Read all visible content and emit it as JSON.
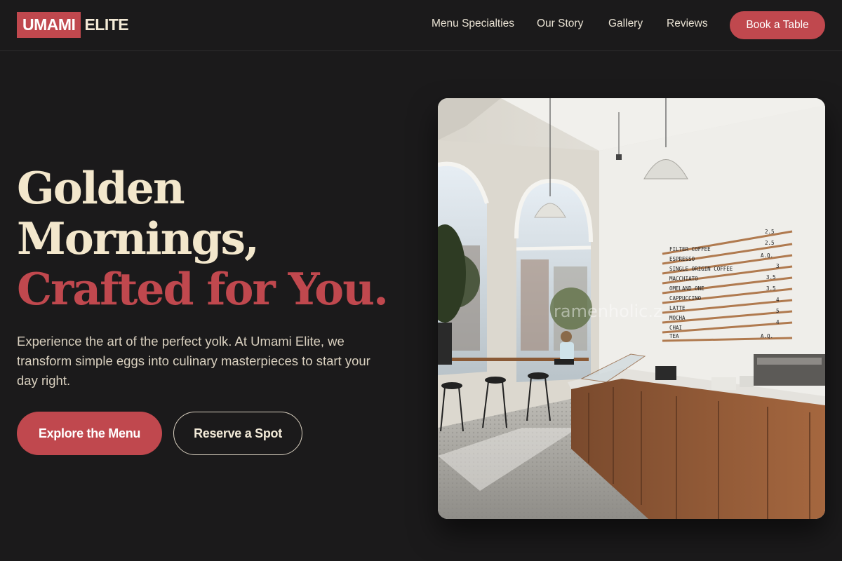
{
  "brand": {
    "logo_highlight": "UMAMI",
    "logo_rest": "ELITE",
    "accent_color": "#c0484e",
    "cream_color": "#f3e7cc",
    "background_color": "#1b1a1b"
  },
  "nav": {
    "links": [
      {
        "label": "Menu Specialties"
      },
      {
        "label": "Our Story"
      },
      {
        "label": "Gallery"
      },
      {
        "label": "Reviews"
      }
    ],
    "cta_label": "Book a Table"
  },
  "hero": {
    "headline_line1": "Golden",
    "headline_line2": "Mornings,",
    "headline_line3": "Crafted for You.",
    "description": "Experience the art of the perfect yolk. At Umami Elite, we transform simple eggs into culinary masterpieces to start your day right.",
    "primary_button": "Explore the Menu",
    "secondary_button": "Reserve a Spot",
    "image": {
      "subject": "bright cafe interior with arched windows, pendant lamps, wooden counter and wall menu board",
      "menu_board": [
        {
          "item": "FILTER COFFEE",
          "price": "2.5"
        },
        {
          "item": "ESPRESSO",
          "price": "2.5"
        },
        {
          "item": "SINGLE ORIGIN COFFEE",
          "price": "A.Q."
        },
        {
          "item": "MACCHIATO",
          "price": "3"
        },
        {
          "item": "OMELAND ONE",
          "price": "3.5"
        },
        {
          "item": "CAPPUCCINO",
          "price": "3.5"
        },
        {
          "item": "LATTE",
          "price": "4"
        },
        {
          "item": "MOCHA",
          "price": "5"
        },
        {
          "item": "CHAI",
          "price": "4"
        },
        {
          "item": "TEA",
          "price": "A.Q."
        }
      ],
      "watermark": "ramenholic.z"
    }
  }
}
